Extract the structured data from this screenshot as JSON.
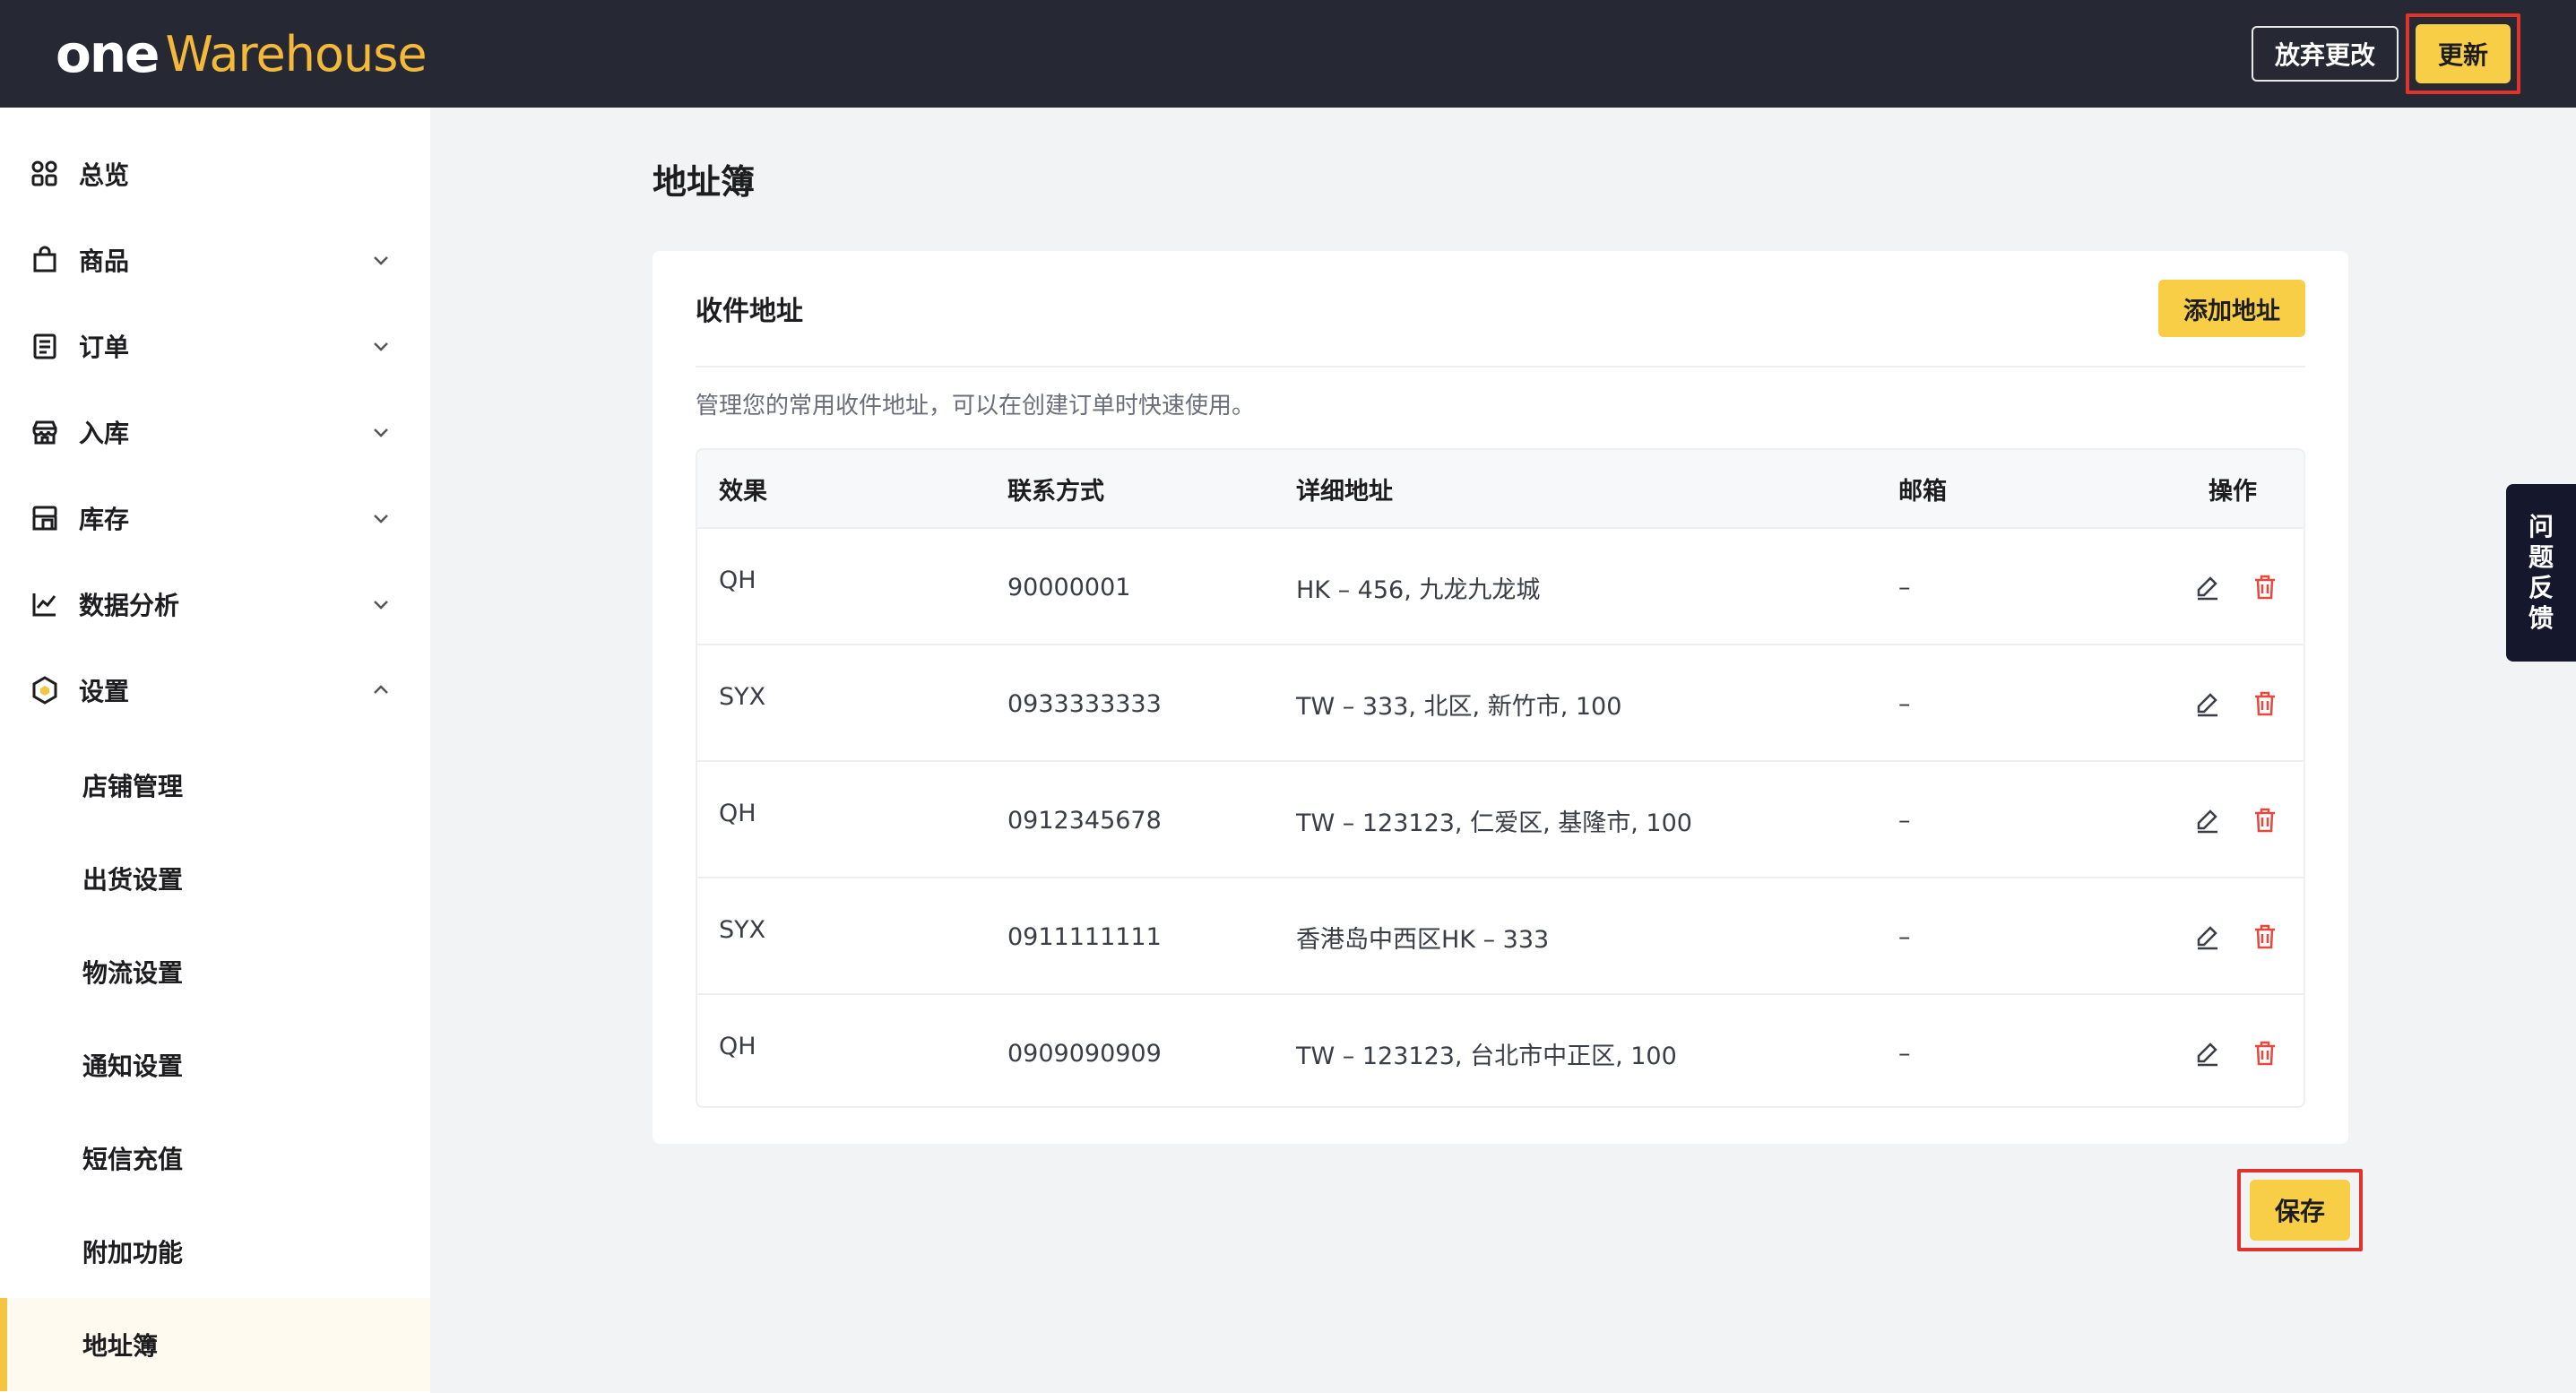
{
  "header": {
    "logo_one": "one",
    "logo_warehouse": "Warehouse",
    "discard_label": "放弃更改",
    "update_label": "更新"
  },
  "sidebar": {
    "items": [
      {
        "label": "总览",
        "icon": "dashboard-icon",
        "chevron": "none"
      },
      {
        "label": "商品",
        "icon": "bag-icon",
        "chevron": "down"
      },
      {
        "label": "订单",
        "icon": "order-icon",
        "chevron": "down"
      },
      {
        "label": "入库",
        "icon": "store-icon",
        "chevron": "down"
      },
      {
        "label": "库存",
        "icon": "inventory-icon",
        "chevron": "down"
      },
      {
        "label": "数据分析",
        "icon": "chart-icon",
        "chevron": "down"
      },
      {
        "label": "设置",
        "icon": "settings-hex-icon",
        "chevron": "up"
      }
    ],
    "sub_items": [
      {
        "label": "店铺管理"
      },
      {
        "label": "出货设置"
      },
      {
        "label": "物流设置"
      },
      {
        "label": "通知设置"
      },
      {
        "label": "短信充值"
      },
      {
        "label": "附加功能"
      },
      {
        "label": "地址簿",
        "active": true
      }
    ]
  },
  "main": {
    "page_title": "地址簿",
    "card_title": "收件地址",
    "add_label": "添加地址",
    "description": "管理您的常用收件地址，可以在创建订单时快速使用。",
    "table": {
      "columns": [
        "效果",
        "联系方式",
        "详细地址",
        "邮箱",
        "操作"
      ],
      "rows": [
        {
          "name": "QH",
          "contact": "90000001",
          "address": "HK – 456, 九龙九龙城",
          "email": "–"
        },
        {
          "name": "SYX",
          "contact": "0933333333",
          "address": "TW – 333, 北区, 新竹市, 100",
          "email": "–"
        },
        {
          "name": "QH",
          "contact": "0912345678",
          "address": "TW – 123123, 仁爱区, 基隆市, 100",
          "email": "–"
        },
        {
          "name": "SYX",
          "contact": "0911111111",
          "address": "香港岛中西区HK – 333",
          "email": "–"
        },
        {
          "name": "QH",
          "contact": "0909090909",
          "address": "TW – 123123, 台北市中正区, 100",
          "email": "–"
        }
      ]
    },
    "save_label": "保存"
  },
  "feedback": {
    "chars": [
      "问",
      "题",
      "反",
      "馈"
    ]
  },
  "colors": {
    "header_bg": "#262833",
    "accent_yellow": "#f7ce46",
    "logo_gold": "#f5b93a",
    "highlight_red": "#e0332c",
    "delete_red": "#e5483f"
  }
}
